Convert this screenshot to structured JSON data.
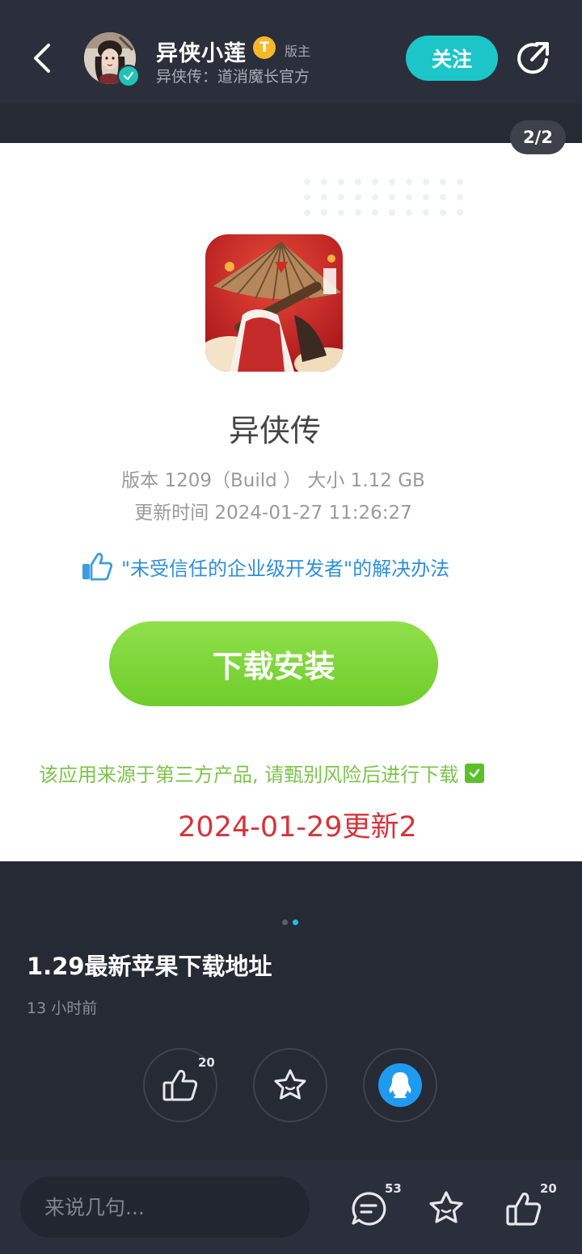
{
  "header": {
    "username": "异侠小莲",
    "rank_badge": "T",
    "role_tag": "版主",
    "subtitle": "异侠传：道消魔长官方",
    "follow_label": "关注"
  },
  "gallery": {
    "page_indicator": "2/2"
  },
  "card": {
    "app_name": "异侠传",
    "version_line": "版本 1209（Build ） 大小 1.12 GB",
    "update_time_line": "更新时间 2024-01-27 11:26:27",
    "trust_link": "\"未受信任的企业级开发者\"的解决办法",
    "download_label": "下载安装",
    "warning": "该应用来源于第三方产品, 请甄别风险后进行下载",
    "update_note": "2024-01-29更新2"
  },
  "post": {
    "title": "1.29最新苹果下载地址",
    "time": "13 小时前"
  },
  "actions": {
    "like_count": "20",
    "icons": [
      "thumbs-up-icon",
      "star-icon",
      "qq-icon"
    ],
    "qq_color": "#1e9bf0"
  },
  "bottom_bar": {
    "comment_placeholder": "来说几句...",
    "comment_count": "53",
    "like_count": "20"
  },
  "colors": {
    "accent": "#1cc5c8",
    "download_green": "#78d135",
    "update_red": "#d8323a",
    "link_blue": "#2f8fda"
  }
}
